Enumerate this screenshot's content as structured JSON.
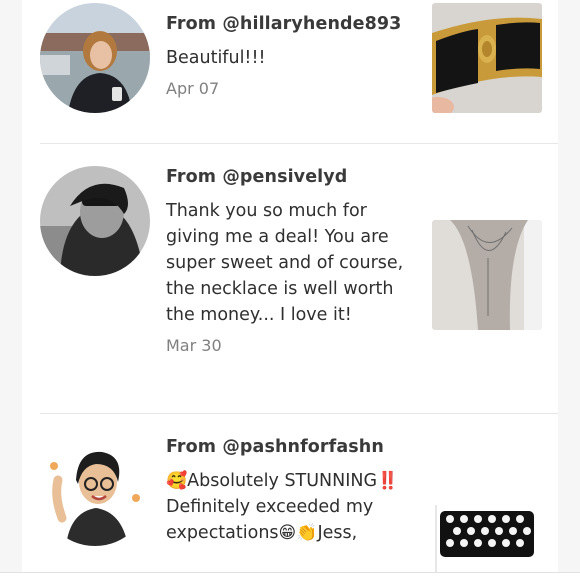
{
  "reviews": [
    {
      "from": "From @hillaryhende893",
      "text": "Beautiful!!!",
      "date": "Apr 07"
    },
    {
      "from": "From @pensivelyd",
      "text": "Thank you so much for giving me a deal! You are super sweet and of course, the necklace is well worth the money... I love it!",
      "date": "Mar 30"
    },
    {
      "from": "From @pashnforfashn",
      "emoji_1": "🥰",
      "text_1": "Absolutely STUNNING",
      "emoji_2": "‼️",
      "text_2": " Definitely exceeded my expectations",
      "emoji_3": "😁👏",
      "text_3": "Jess,"
    }
  ]
}
